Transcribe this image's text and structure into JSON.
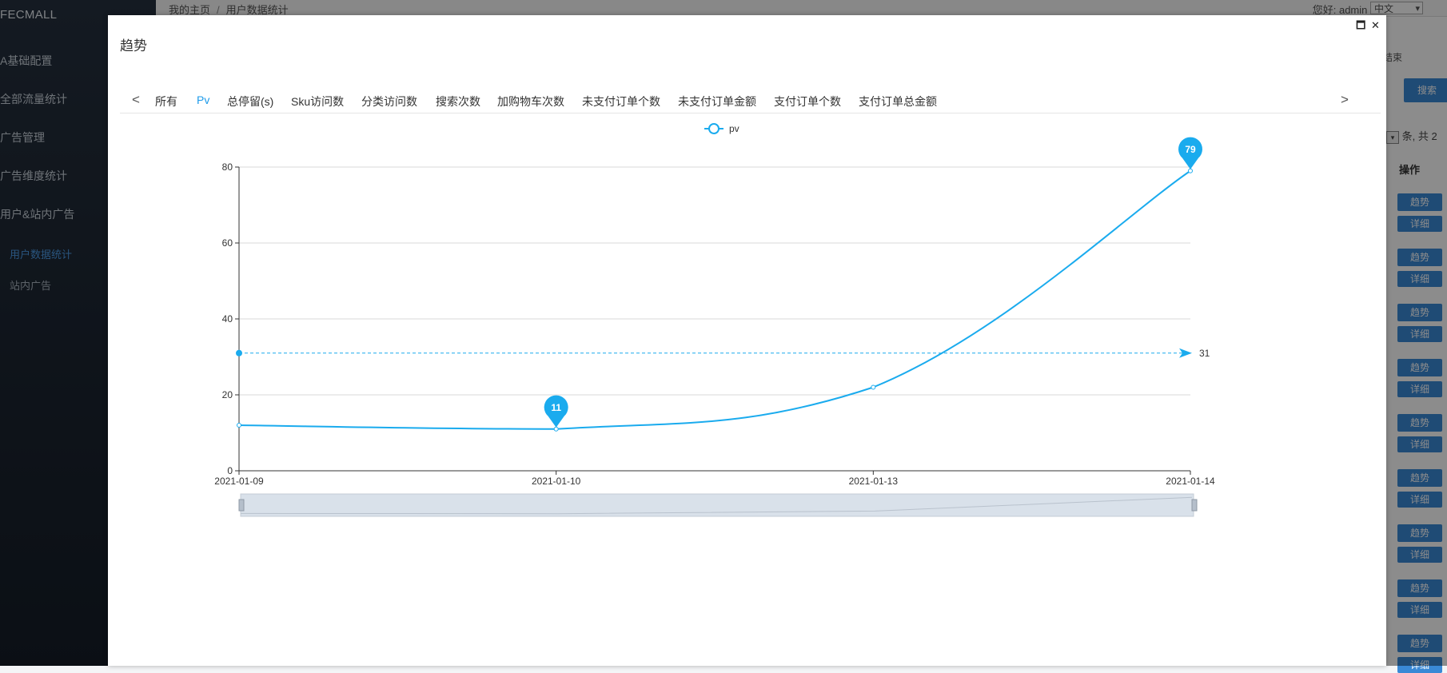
{
  "app": {
    "brand": "FECMALL",
    "nav": [
      {
        "label": "A基础配置"
      },
      {
        "label": "全部流量统计"
      },
      {
        "label": "广告管理"
      },
      {
        "label": "广告维度统计"
      },
      {
        "label": "用户&站内广告"
      }
    ],
    "subnav": [
      {
        "label": "用户数据统计",
        "active": true
      },
      {
        "label": "站内广告",
        "active": false
      }
    ],
    "breadcrumb": {
      "home": "我的主页",
      "sep": "/",
      "current": "用户数据统计"
    },
    "greeting": "您好: admin",
    "language": "中文",
    "right_label": "结束",
    "search_label": "搜索",
    "pager_text": "条, 共 2",
    "col_ops": "操作",
    "row_buttons": {
      "trend": "趋势",
      "detail": "详细"
    }
  },
  "modal": {
    "title": "趋势",
    "tabs": [
      {
        "label": "所有",
        "active": false
      },
      {
        "label": "Pv",
        "active": true
      },
      {
        "label": "总停留(s)",
        "active": false
      },
      {
        "label": "Sku访问数",
        "active": false
      },
      {
        "label": "分类访问数",
        "active": false
      },
      {
        "label": "搜索次数",
        "active": false
      },
      {
        "label": "加购物车次数",
        "active": false
      },
      {
        "label": "未支付订单个数",
        "active": false
      },
      {
        "label": "未支付订单金额",
        "active": false
      },
      {
        "label": "支付订单个数",
        "active": false
      },
      {
        "label": "支付订单总金额",
        "active": false
      }
    ],
    "prev_symbol": "<",
    "next_symbol": ">",
    "maximize_symbol": "🗖",
    "close_symbol": "✕"
  },
  "chart_data": {
    "type": "line",
    "title": "",
    "x": [
      "2021-01-09",
      "2021-01-10",
      "2021-01-13",
      "2021-01-14"
    ],
    "series": [
      {
        "name": "pv",
        "values": [
          12,
          11,
          22,
          79
        ],
        "color": "#1aabee"
      }
    ],
    "ylim": [
      0,
      80
    ],
    "yticks": [
      0,
      20,
      40,
      60,
      80
    ],
    "mark_points": [
      {
        "label": "11",
        "x": "2021-01-10",
        "y": 11
      },
      {
        "label": "79",
        "x": "2021-01-14",
        "y": 79
      }
    ],
    "mark_line": {
      "label": "31",
      "value": 31
    },
    "legend": "top-center",
    "grid": true,
    "data_zoom": true
  }
}
